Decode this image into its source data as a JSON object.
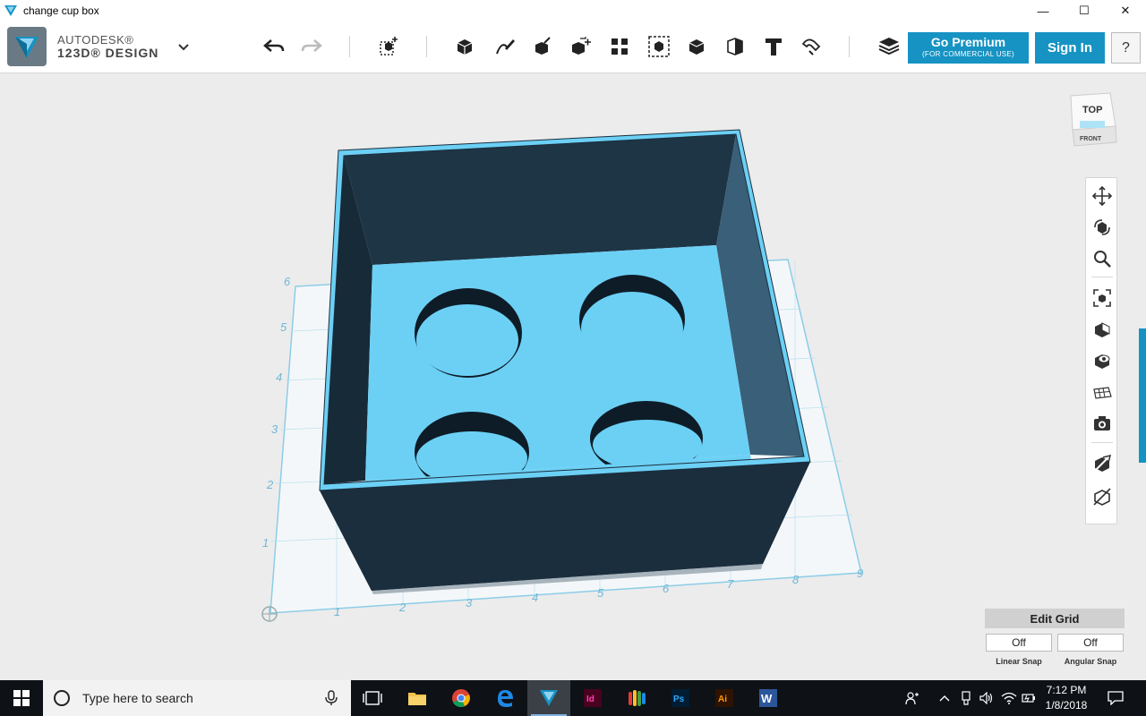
{
  "window": {
    "title": "change cup box",
    "controls": {
      "minimize": "—",
      "maximize": "☐",
      "close": "✕"
    }
  },
  "brand": {
    "line1": "AUTODESK®",
    "line2": "123D® DESIGN"
  },
  "toolbar": {
    "icons": [
      "undo-icon",
      "redo-icon",
      "primitives-icon",
      "sketch-icon",
      "construct-icon",
      "modify-icon",
      "pattern-icon",
      "grouping-icon",
      "combine-icon",
      "measure-icon",
      "text-icon",
      "snap-icon",
      "materials-icon"
    ],
    "go_premium": "Go Premium",
    "go_premium_sub": "(FOR COMMERCIAL USE)",
    "sign_in": "Sign In",
    "help": "?"
  },
  "viewcube": {
    "top": "TOP",
    "front": "FRONT"
  },
  "grid": {
    "left_labels": [
      "1",
      "2",
      "3",
      "4",
      "5",
      "6"
    ],
    "bottom_labels": [
      "1",
      "2",
      "3",
      "4",
      "5",
      "6",
      "7",
      "8",
      "9"
    ]
  },
  "edit_grid": {
    "title": "Edit Grid",
    "linear_value": "Off",
    "angular_value": "Off",
    "linear_caption": "Linear Snap",
    "angular_caption": "Angular Snap"
  },
  "colors": {
    "accent": "#1693c3",
    "model_dark": "#1b2e3e",
    "model_light": "#6cd0f5",
    "grid": "#8ccde8"
  },
  "taskbar": {
    "search_placeholder": "Type here to search",
    "time": "7:12 PM",
    "date": "1/8/2018",
    "apps": [
      "task-view-icon",
      "file-explorer-icon",
      "chrome-icon",
      "edge-icon",
      "123d-design-icon",
      "indesign-icon",
      "app-icon",
      "photoshop-icon",
      "illustrator-icon",
      "word-icon"
    ],
    "app_labels": {
      "indesign": "Id",
      "photoshop": "Ps",
      "illustrator": "Ai",
      "word": "W"
    }
  }
}
